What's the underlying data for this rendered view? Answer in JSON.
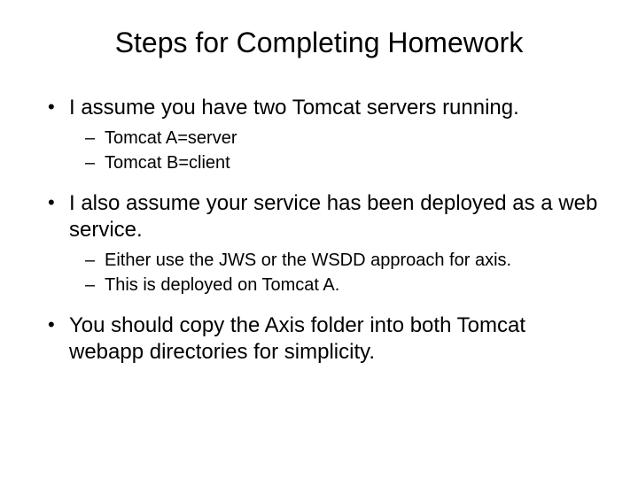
{
  "title": "Steps for Completing Homework",
  "bullets": [
    {
      "text": "I assume you have two Tomcat servers running.",
      "sub": [
        "Tomcat A=server",
        "Tomcat B=client"
      ]
    },
    {
      "text": "I also assume your service has been deployed as a web service.",
      "sub": [
        "Either use the JWS or the WSDD approach for axis.",
        "This is deployed on Tomcat A."
      ]
    },
    {
      "text": "You should copy the Axis folder into both Tomcat webapp directories for simplicity.",
      "sub": []
    }
  ]
}
